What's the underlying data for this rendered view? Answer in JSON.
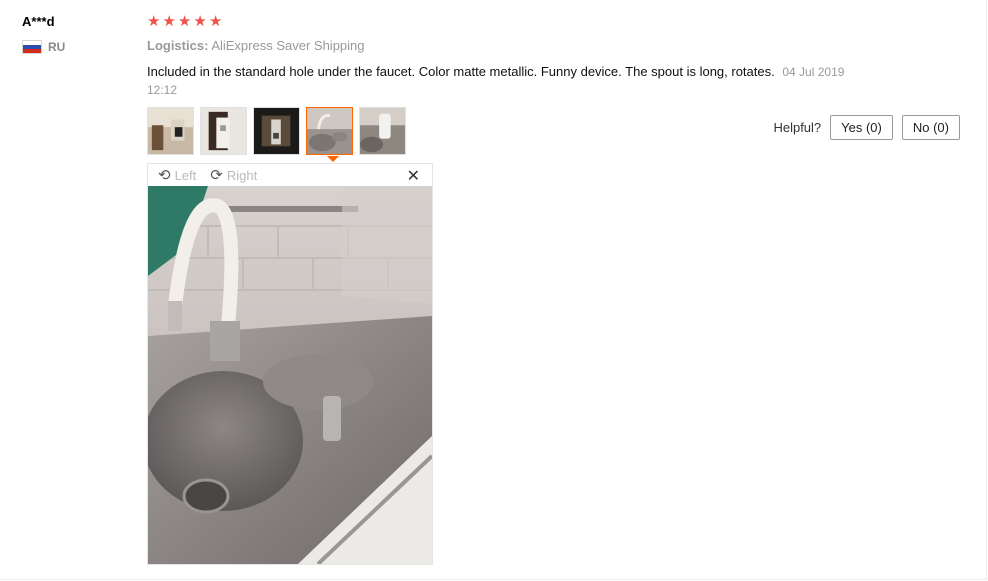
{
  "review": {
    "user": "A***d",
    "country": "RU",
    "rating": 5,
    "logistics_label": "Logistics:",
    "logistics_value": "AliExpress Saver Shipping",
    "text": "Included in the standard hole under the faucet. Color matte metallic. Funny device. The spout is long, rotates.",
    "date": "04 Jul 2019 12:12"
  },
  "helpful": {
    "label": "Helpful?",
    "yes": "Yes (0)",
    "no": "No (0)"
  },
  "viewer": {
    "left_label": "Left",
    "right_label": "Right",
    "close_symbol": "✕"
  },
  "icons": [
    "star-icon",
    "flag-icon",
    "rotate-left-icon",
    "rotate-right-icon",
    "close-icon"
  ],
  "colors": {
    "star": "#f0524c",
    "active_thumb": "#ff6600"
  }
}
